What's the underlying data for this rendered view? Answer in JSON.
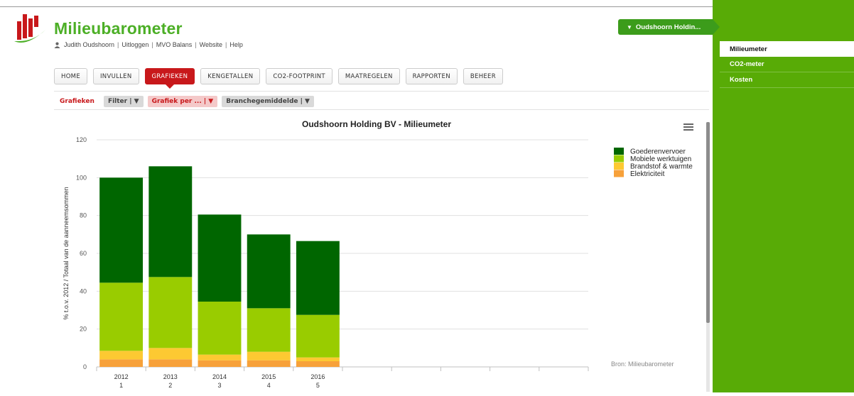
{
  "app": {
    "title": "Milieubarometer",
    "user": "Judith Oudshoorn",
    "links": [
      "Uitloggen",
      "MVO Balans",
      "Website",
      "Help"
    ]
  },
  "nav": {
    "items": [
      {
        "label": "HOME",
        "active": false
      },
      {
        "label": "INVULLEN",
        "active": false
      },
      {
        "label": "GRAFIEKEN",
        "active": true
      },
      {
        "label": "KENGETALLEN",
        "active": false
      },
      {
        "label": "CO2-FOOTPRINT",
        "active": false
      },
      {
        "label": "MAATREGELEN",
        "active": false
      },
      {
        "label": "RAPPORTEN",
        "active": false
      },
      {
        "label": "BEHEER",
        "active": false
      }
    ]
  },
  "subnav": {
    "label": "Grafieken",
    "filter": "Filter | ▼",
    "grafiek_per": "Grafiek per ... | ▼",
    "branche": "Branchegemiddelde | ▼"
  },
  "tenant": {
    "label": "Oudshoorn Holdin..."
  },
  "side_menu": [
    {
      "label": "Milieumeter",
      "active": true
    },
    {
      "label": "CO2-meter",
      "active": false
    },
    {
      "label": "Kosten",
      "active": false
    }
  ],
  "colors": {
    "brand": "#4caf26",
    "accent_red": "#c8181b",
    "sidebar": "#58ab06"
  },
  "chart_data": {
    "type": "bar",
    "stacked": true,
    "title": "Oudshoorn Holding BV - Milieumeter",
    "ylabel": "% t.o.v. 2012 / Totaal van de aanneemsommen",
    "ylim": [
      0,
      120
    ],
    "yticks": [
      0,
      20,
      40,
      60,
      80,
      100,
      120
    ],
    "categories": [
      "2012",
      "2013",
      "2014",
      "2015",
      "2016"
    ],
    "category_sublabels": [
      "1",
      "2",
      "3",
      "4",
      "5"
    ],
    "empty_slots": 5,
    "series": [
      {
        "name": "Elektriciteit",
        "color": "#f7a13a",
        "values": [
          4,
          4,
          3.5,
          3.5,
          3
        ]
      },
      {
        "name": "Brandstof & warmte",
        "color": "#fdc932",
        "values": [
          4.5,
          6,
          3,
          4.5,
          2
        ]
      },
      {
        "name": "Mobiele werktuigen",
        "color": "#99cc00",
        "values": [
          36,
          37.5,
          28,
          23,
          22.5
        ]
      },
      {
        "name": "Goederenvervoer",
        "color": "#006600",
        "values": [
          55.5,
          58.5,
          46,
          39,
          39
        ]
      }
    ],
    "legend": "right",
    "grid": true,
    "credits": "Bron: Milieubarometer"
  }
}
